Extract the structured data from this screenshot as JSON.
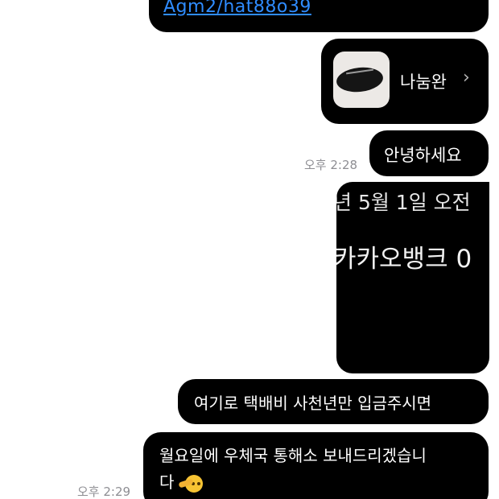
{
  "colors": {
    "bubble_bg": "#000000",
    "bubble_text": "#ffffff",
    "link": "#2f8cff",
    "timestamp": "#8e8e93",
    "background": "#ffffff"
  },
  "messages": {
    "link_text": "Agm2/hat88o39",
    "card": {
      "label": "나눔완",
      "thumbnail_icon": "product-thumbnail",
      "chevron": "›"
    },
    "greeting": "안녕하세요",
    "time_1": "오후 2:28",
    "image": {
      "line_1": "년 5월 1일 오전",
      "line_2": "카카오뱅크 0"
    },
    "text_1": "여기로 택배비 사천년만 입금주시면",
    "text_2_line_1": "월요일에 우체국 통해소 보내드리겠습니",
    "text_2_line_2": "다",
    "text_2_emoji": "saluting-face-emoji",
    "time_2": "오후 2:29"
  }
}
